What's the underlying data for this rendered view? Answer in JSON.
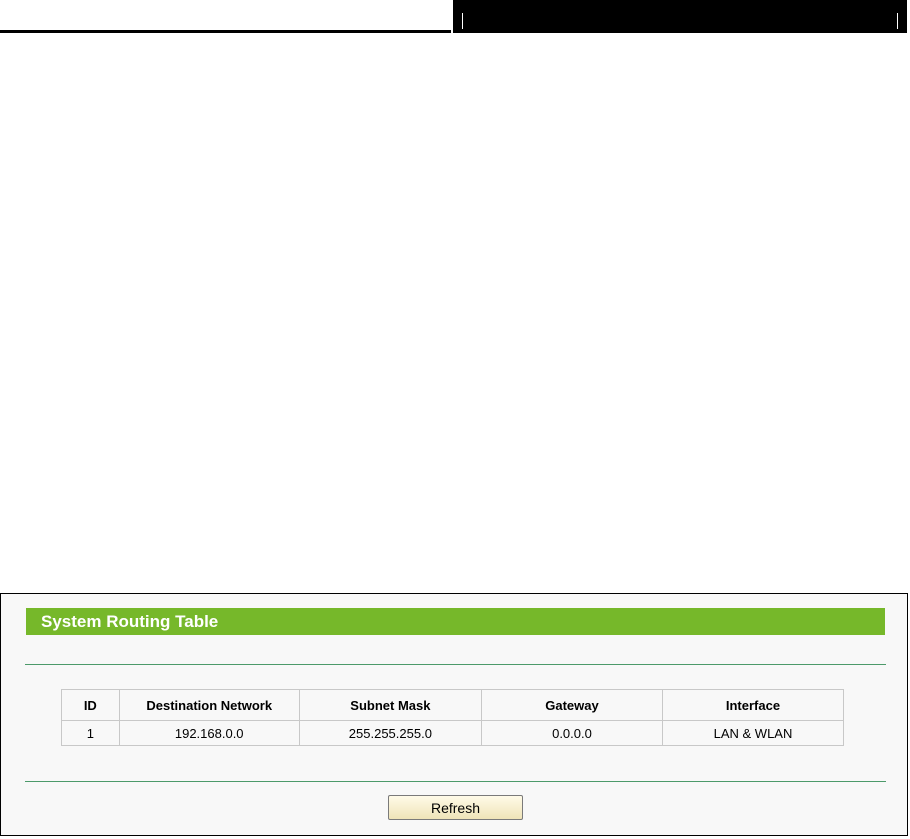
{
  "panel": {
    "title": "System Routing Table"
  },
  "table": {
    "headers": [
      "ID",
      "Destination Network",
      "Subnet Mask",
      "Gateway",
      "Interface"
    ],
    "rows": [
      [
        "1",
        "192.168.0.0",
        "255.255.255.0",
        "0.0.0.0",
        "LAN & WLAN"
      ]
    ]
  },
  "actions": {
    "refresh_label": "Refresh"
  },
  "colors": {
    "title_bar": "#76b82a",
    "rule": "#4c9a6a",
    "header_bar": "#000000"
  }
}
